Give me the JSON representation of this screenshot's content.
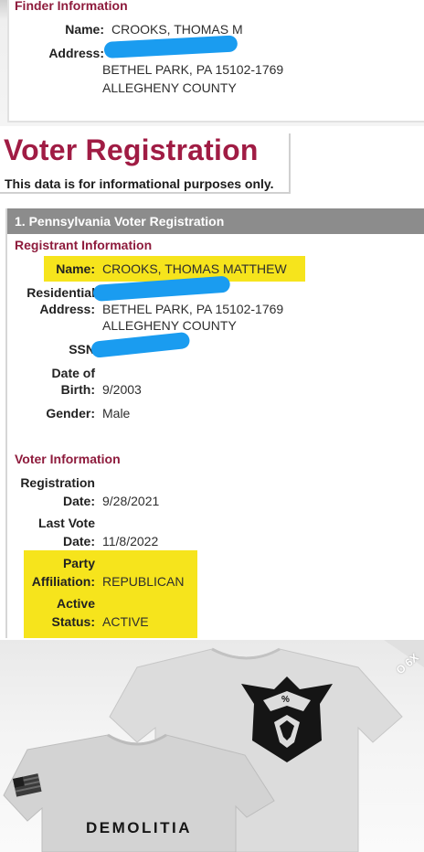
{
  "finder": {
    "title": "Finder Information",
    "name_label": "Name:",
    "name_value": "CROOKS, THOMAS M",
    "address_label": "Address:",
    "address_line2": "BETHEL PARK, PA 15102-1769",
    "address_line3": "ALLEGHENY COUNTY"
  },
  "voter_registration": {
    "title": "Voter Registration",
    "note": "This data is for informational purposes only."
  },
  "registration": {
    "section_title": "1. Pennsylvania Voter Registration",
    "registrant_heading": "Registrant Information",
    "name_label": "Name:",
    "name_value": "CROOKS, THOMAS MATTHEW",
    "residential_label_1": "Residential",
    "residential_label_2": "Address:",
    "address_line2": "BETHEL PARK, PA 15102-1769",
    "address_line3": "ALLEGHENY COUNTY",
    "ssn_label": "SSN",
    "dob_label_1": "Date of",
    "dob_label_2": "Birth:",
    "dob_value": "9/2003",
    "gender_label": "Gender:",
    "gender_value": "Male",
    "voter_heading": "Voter Information",
    "reg_date_label_1": "Registration",
    "reg_date_label_2": "Date:",
    "reg_date_value": "9/28/2021",
    "last_vote_label_1": "Last Vote",
    "last_vote_label_2": "Date:",
    "last_vote_value": "11/8/2022",
    "party_label_1": "Party",
    "party_label_2": "Affiliation:",
    "party_value": "REPUBLICAN",
    "status_label_1": "Active",
    "status_label_2": "Status:",
    "status_value": "ACTIVE"
  },
  "photo": {
    "brand": "DEMOLITIA",
    "logo_text": "%",
    "corner_text": "O 6X"
  },
  "colors": {
    "accent": "#a01c44",
    "highlight": "#f6e41c",
    "redaction": "#1a9cf0",
    "section_bar": "#8c8c8c"
  }
}
